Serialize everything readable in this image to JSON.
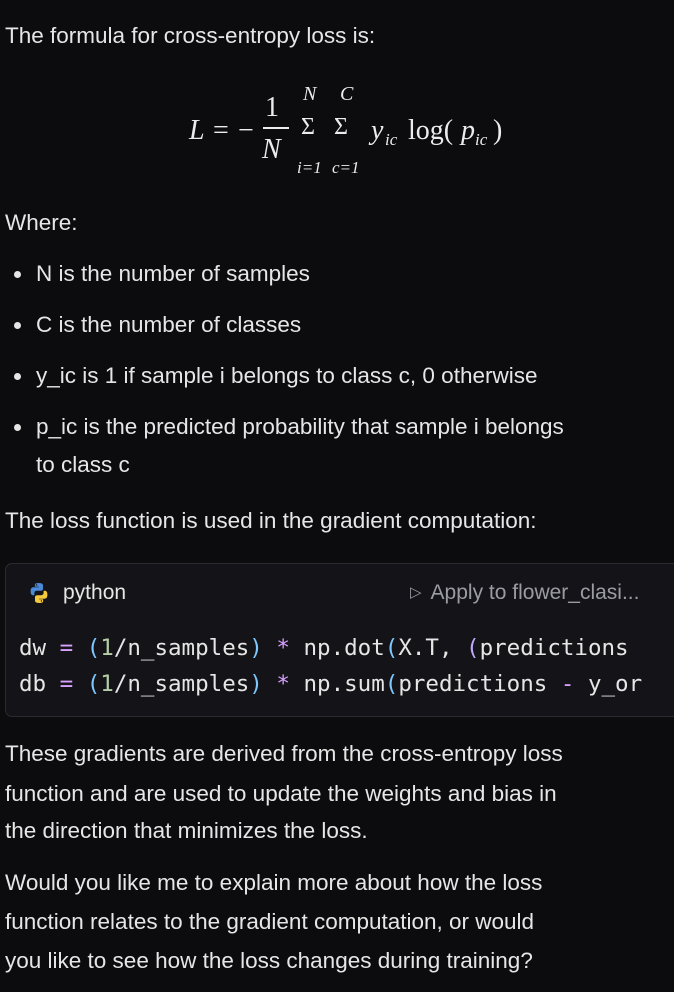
{
  "intro": "The formula for cross-entropy loss is:",
  "formula": {
    "lhs": "L",
    "equals": "=",
    "minus": "−",
    "numerator": "1",
    "denominator": "N",
    "sum1_top": "N",
    "sum1_bottom": "i=1",
    "sum2_top": "C",
    "sum2_bottom": "c=1",
    "sigma": "Σ",
    "term_y": "y",
    "term_y_sub": "ic",
    "term_log": "log(",
    "term_p": "p",
    "term_p_sub": "ic",
    "term_close": ")"
  },
  "where_label": "Where:",
  "bullets": [
    "N is the number of samples",
    "C is the number of classes",
    "y_ic is 1 if sample i belongs to class c, 0 otherwise",
    "p_ic is the predicted probability that sample i belongs"
  ],
  "bullet4_line2": "to class c",
  "loss_used": "The loss function is used in the gradient computation:",
  "code": {
    "language": "python",
    "apply_label": "Apply to flower_clasi...",
    "line1": {
      "a": "dw",
      "eq": "=",
      "open": "(",
      "one": "1",
      "slash": "/n_samples",
      "close": ")",
      "star": "*",
      "fn": "np.dot",
      "open2": "(",
      "args": "X.T, ",
      "open3": "(",
      "rest": "predictions"
    },
    "line2": {
      "a": "db",
      "eq": "=",
      "open": "(",
      "one": "1",
      "slash": "/n_samples",
      "close": ")",
      "star": "*",
      "fn": "np.sum",
      "open2": "(",
      "args": "predictions ",
      "minus": "-",
      "rest": " y_or"
    }
  },
  "gradients_text": [
    "These gradients are derived from the cross-entropy loss",
    "function and are used to update the weights and bias in",
    "the direction that minimizes the loss."
  ],
  "question_text": [
    "Would you like me to explain more about how the loss",
    "function relates to the gradient computation, or would",
    "you like to see how the loss changes during training?"
  ]
}
